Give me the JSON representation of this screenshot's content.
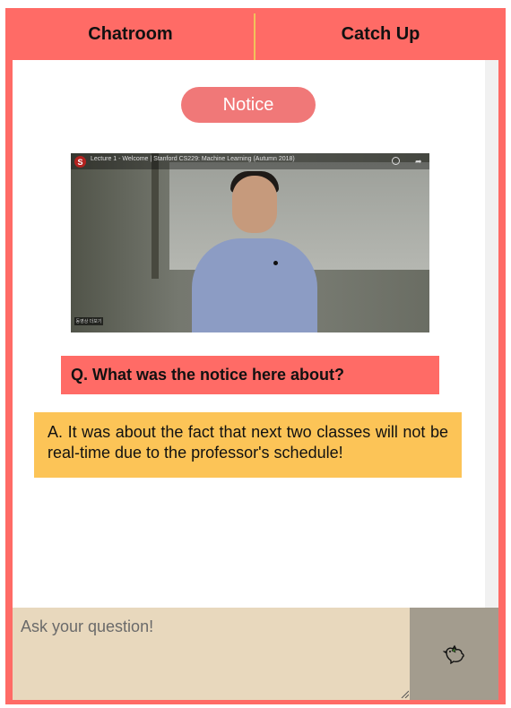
{
  "tabs": [
    {
      "label": "Chatroom"
    },
    {
      "label": "Catch Up"
    }
  ],
  "notice": {
    "label": "Notice"
  },
  "video": {
    "title": "Lecture 1 - Welcome | Stanford CS229: Machine Learning (Autumn 2018)",
    "logo_letter": "S",
    "caption_chip": "동영상 더보기",
    "icons": [
      "clock-icon",
      "share-icon"
    ]
  },
  "qa": {
    "question": "Q. What was the notice here about?",
    "answer": "A. It was about the fact that next two classes will not be real-time due to the professor's schedule!"
  },
  "composer": {
    "placeholder": "Ask your question!",
    "value": "",
    "send_icon": "bird-icon"
  },
  "colors": {
    "frame": "#ff6b66",
    "tab_divider": "#f2c25a",
    "notice_pill": "#f07878",
    "question_bg": "#ff6b66",
    "answer_bg": "#fcc457",
    "input_bg": "#e8d8bd",
    "send_bg": "#a39c8e"
  }
}
